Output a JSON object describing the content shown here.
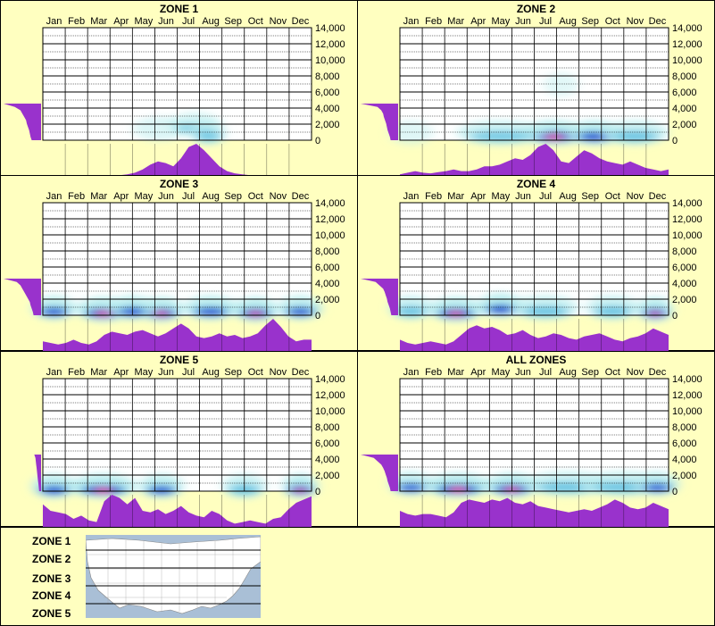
{
  "months": [
    "Jan",
    "Feb",
    "Mar",
    "Apr",
    "May",
    "Jun",
    "Jul",
    "Aug",
    "Sep",
    "Oct",
    "Nov",
    "Dec"
  ],
  "y_ticks": [
    "14,000",
    "12,000",
    "10,000",
    "8,000",
    "6,000",
    "4,000",
    "2,000",
    "0"
  ],
  "colors": {
    "background": "#ffffc0",
    "purple": "#9932cc",
    "heat_light": "#bfeff0",
    "heat_mid": "#2aa8d8",
    "heat_dark": "#0000cc",
    "heat_peak": "#ff1493"
  },
  "chart_data": [
    {
      "type": "heatmap",
      "title": "ZONE 1",
      "ylim": [
        0,
        14000
      ],
      "x_profile": [
        0,
        0,
        0,
        0,
        0,
        0,
        0,
        0,
        0,
        0,
        0.02,
        0.05,
        0.1,
        0.2,
        0.35,
        0.45,
        0.4,
        0.3,
        0.55,
        0.9,
        1,
        0.8,
        0.55,
        0.3,
        0.15,
        0.08,
        0.05,
        0.02,
        0,
        0,
        0,
        0,
        0,
        0,
        0,
        0
      ],
      "elev_profile": [
        0.25,
        0.28,
        0.3,
        0.32,
        0.35,
        0.38,
        0.4,
        0.45,
        0.5,
        0.55,
        0.7,
        1
      ],
      "hotspots": [
        {
          "month": 5.2,
          "elev": 1000,
          "w": 1.2,
          "i": 0.35
        },
        {
          "month": 6.8,
          "elev": 1500,
          "w": 1.2,
          "i": 0.45
        },
        {
          "month": 7.4,
          "elev": 500,
          "w": 0.8,
          "i": 0.55
        }
      ]
    },
    {
      "type": "heatmap",
      "title": "ZONE 2",
      "ylim": [
        0,
        14000
      ],
      "x_profile": [
        0.05,
        0.1,
        0.15,
        0.1,
        0.08,
        0.12,
        0.15,
        0.2,
        0.15,
        0.15,
        0.2,
        0.3,
        0.3,
        0.35,
        0.45,
        0.55,
        0.5,
        0.65,
        0.9,
        1,
        0.8,
        0.45,
        0.4,
        0.6,
        0.8,
        0.7,
        0.55,
        0.45,
        0.4,
        0.35,
        0.45,
        0.35,
        0.25,
        0.2,
        0.15,
        0.2
      ],
      "elev_profile": [
        0.2,
        0.22,
        0.25,
        0.28,
        0.3,
        0.32,
        0.35,
        0.38,
        0.4,
        0.45,
        0.55,
        1
      ],
      "hotspots": [
        {
          "month": 0.5,
          "elev": 500,
          "w": 1,
          "i": 0.3
        },
        {
          "month": 6.9,
          "elev": 500,
          "w": 1.5,
          "i": 1
        },
        {
          "month": 8.7,
          "elev": 500,
          "w": 1.2,
          "i": 0.85
        },
        {
          "month": 4.5,
          "elev": 500,
          "w": 2,
          "i": 0.55
        },
        {
          "month": 10.5,
          "elev": 500,
          "w": 1.5,
          "i": 0.6
        },
        {
          "month": 7.2,
          "elev": 6500,
          "w": 0.8,
          "i": 0.25
        }
      ]
    },
    {
      "type": "heatmap",
      "title": "ZONE 3",
      "ylim": [
        0,
        14000
      ],
      "x_profile": [
        0.3,
        0.25,
        0.2,
        0.25,
        0.35,
        0.25,
        0.2,
        0.3,
        0.5,
        0.6,
        0.55,
        0.5,
        0.6,
        0.65,
        0.55,
        0.45,
        0.55,
        0.7,
        0.85,
        0.7,
        0.45,
        0.4,
        0.45,
        0.55,
        0.45,
        0.5,
        0.4,
        0.45,
        0.55,
        0.8,
        1,
        0.75,
        0.45,
        0.3,
        0.35,
        0.35
      ],
      "elev_profile": [
        0.2,
        0.22,
        0.25,
        0.28,
        0.3,
        0.35,
        0.4,
        0.45,
        0.5,
        0.55,
        0.65,
        1
      ],
      "hotspots": [
        {
          "month": 2.7,
          "elev": 300,
          "w": 1.2,
          "i": 1
        },
        {
          "month": 5.3,
          "elev": 300,
          "w": 1,
          "i": 1
        },
        {
          "month": 9.5,
          "elev": 300,
          "w": 1,
          "i": 1
        },
        {
          "month": 0.5,
          "elev": 500,
          "w": 1,
          "i": 0.7
        },
        {
          "month": 4,
          "elev": 500,
          "w": 1,
          "i": 0.75
        },
        {
          "month": 7.5,
          "elev": 500,
          "w": 1.2,
          "i": 0.75
        },
        {
          "month": 11.5,
          "elev": 500,
          "w": 1,
          "i": 0.7
        }
      ]
    },
    {
      "type": "heatmap",
      "title": "ZONE 4",
      "ylim": [
        0,
        14000
      ],
      "x_profile": [
        0.35,
        0.25,
        0.2,
        0.25,
        0.3,
        0.25,
        0.2,
        0.3,
        0.5,
        0.7,
        0.8,
        0.7,
        0.75,
        0.65,
        0.5,
        0.55,
        0.65,
        0.5,
        0.4,
        0.45,
        0.55,
        0.5,
        0.4,
        0.35,
        0.45,
        0.5,
        0.55,
        0.45,
        0.35,
        0.3,
        0.4,
        0.45,
        0.55,
        0.7,
        0.6,
        0.5
      ],
      "elev_profile": [
        0.18,
        0.2,
        0.22,
        0.25,
        0.28,
        0.3,
        0.33,
        0.36,
        0.4,
        0.5,
        0.6,
        1
      ],
      "hotspots": [
        {
          "month": 2.5,
          "elev": 300,
          "w": 1.2,
          "i": 1
        },
        {
          "month": 4.5,
          "elev": 800,
          "w": 1,
          "i": 0.85
        },
        {
          "month": 11.4,
          "elev": 300,
          "w": 0.8,
          "i": 0.95
        },
        {
          "month": 6.5,
          "elev": 500,
          "w": 1.5,
          "i": 0.6
        },
        {
          "month": 9.5,
          "elev": 500,
          "w": 1.2,
          "i": 0.6
        },
        {
          "month": 0.5,
          "elev": 500,
          "w": 1,
          "i": 0.6
        }
      ]
    },
    {
      "type": "heatmap",
      "title": "ZONE 5",
      "ylim": [
        0,
        14000
      ],
      "x_profile": [
        0.7,
        0.5,
        0.45,
        0.4,
        0.25,
        0.35,
        0.2,
        0.15,
        0.8,
        1,
        0.9,
        0.7,
        0.9,
        0.5,
        0.45,
        0.55,
        0.4,
        0.5,
        0.65,
        0.45,
        0.35,
        0.3,
        0.5,
        0.4,
        0.2,
        0.1,
        0.15,
        0.2,
        0.15,
        0.1,
        0.25,
        0.3,
        0.55,
        0.75,
        0.85,
        0.95
      ],
      "elev_profile": [
        0.05,
        0.06,
        0.07,
        0.08,
        0.09,
        0.1,
        0.11,
        0.12,
        0.13,
        0.14,
        0.15,
        0.18
      ],
      "hotspots": [
        {
          "month": 2.7,
          "elev": 200,
          "w": 1.5,
          "i": 1
        },
        {
          "month": 11.5,
          "elev": 200,
          "w": 0.8,
          "i": 0.95
        },
        {
          "month": 0.5,
          "elev": 200,
          "w": 1,
          "i": 0.75
        },
        {
          "month": 5.3,
          "elev": 200,
          "w": 1,
          "i": 0.7
        },
        {
          "month": 9,
          "elev": 200,
          "w": 1,
          "i": 0.6
        }
      ]
    },
    {
      "type": "heatmap",
      "title": "ALL ZONES",
      "ylim": [
        0,
        14000
      ],
      "x_profile": [
        0.5,
        0.4,
        0.35,
        0.4,
        0.4,
        0.35,
        0.3,
        0.45,
        0.75,
        0.85,
        0.8,
        0.75,
        0.85,
        0.8,
        0.9,
        0.75,
        0.7,
        0.8,
        0.65,
        0.6,
        0.55,
        0.5,
        0.45,
        0.5,
        0.55,
        0.5,
        0.6,
        0.7,
        0.85,
        0.75,
        0.6,
        0.55,
        0.6,
        0.75,
        0.65,
        0.55
      ],
      "elev_profile": [
        0.2,
        0.22,
        0.25,
        0.28,
        0.3,
        0.33,
        0.36,
        0.4,
        0.45,
        0.55,
        0.65,
        1
      ],
      "hotspots": [
        {
          "month": 2.6,
          "elev": 300,
          "w": 1.5,
          "i": 1
        },
        {
          "month": 5,
          "elev": 300,
          "w": 1.2,
          "i": 1
        },
        {
          "month": 7.5,
          "elev": 500,
          "w": 2,
          "i": 0.6
        },
        {
          "month": 10,
          "elev": 500,
          "w": 2,
          "i": 0.6
        },
        {
          "month": 11.5,
          "elev": 500,
          "w": 1,
          "i": 0.65
        },
        {
          "month": 0.5,
          "elev": 500,
          "w": 1,
          "i": 0.65
        }
      ]
    }
  ],
  "legend": {
    "zones": [
      "ZONE 1",
      "ZONE 2",
      "ZONE 3",
      "ZONE 4",
      "ZONE 5"
    ]
  }
}
